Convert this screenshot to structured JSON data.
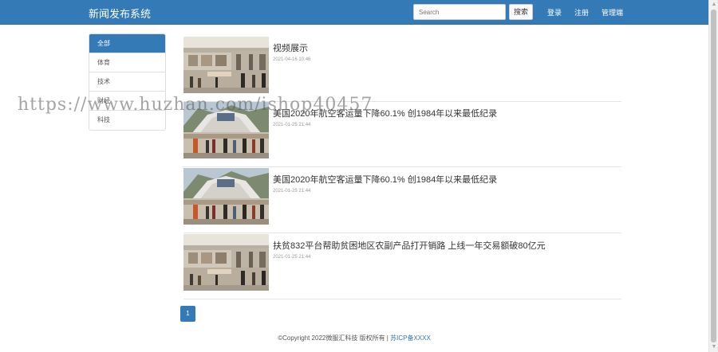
{
  "header": {
    "brand": "新闻发布系统",
    "search_placeholder": "Search",
    "search_button": "搜索",
    "nav": [
      "登录",
      "注册",
      "管理端"
    ]
  },
  "sidebar": {
    "items": [
      {
        "label": "全部",
        "active": true
      },
      {
        "label": "体育",
        "active": false
      },
      {
        "label": "技术",
        "active": false
      },
      {
        "label": "财经",
        "active": false
      },
      {
        "label": "科技",
        "active": false
      }
    ]
  },
  "articles": [
    {
      "title": "视频展示",
      "date": "2021-04-16 10:46",
      "thumb": "mall-interior"
    },
    {
      "title": "美国2020年航空客运量下降60.1% 创1984年以来最低纪录",
      "date": "2021-01-25 21:44",
      "thumb": "mall-tent"
    },
    {
      "title": "美国2020年航空客运量下降60.1% 创1984年以来最低纪录",
      "date": "2021-01-25 21:44",
      "thumb": "mall-tent"
    },
    {
      "title": "扶贫832平台帮助贫困地区农副产品打开销路 上线一年交易额破80亿元",
      "date": "2021-01-25 21:44",
      "thumb": "mall-interior"
    }
  ],
  "pagination": {
    "current": "1"
  },
  "footer": {
    "copyright": "©Copyright 2022微服汇科技 版权所有 | ",
    "icp": "苏ICP备XXXX"
  },
  "watermark": "https://www.huzhan.com/ishop40457",
  "colors": {
    "primary": "#337ab7",
    "border": "#dddddd"
  }
}
